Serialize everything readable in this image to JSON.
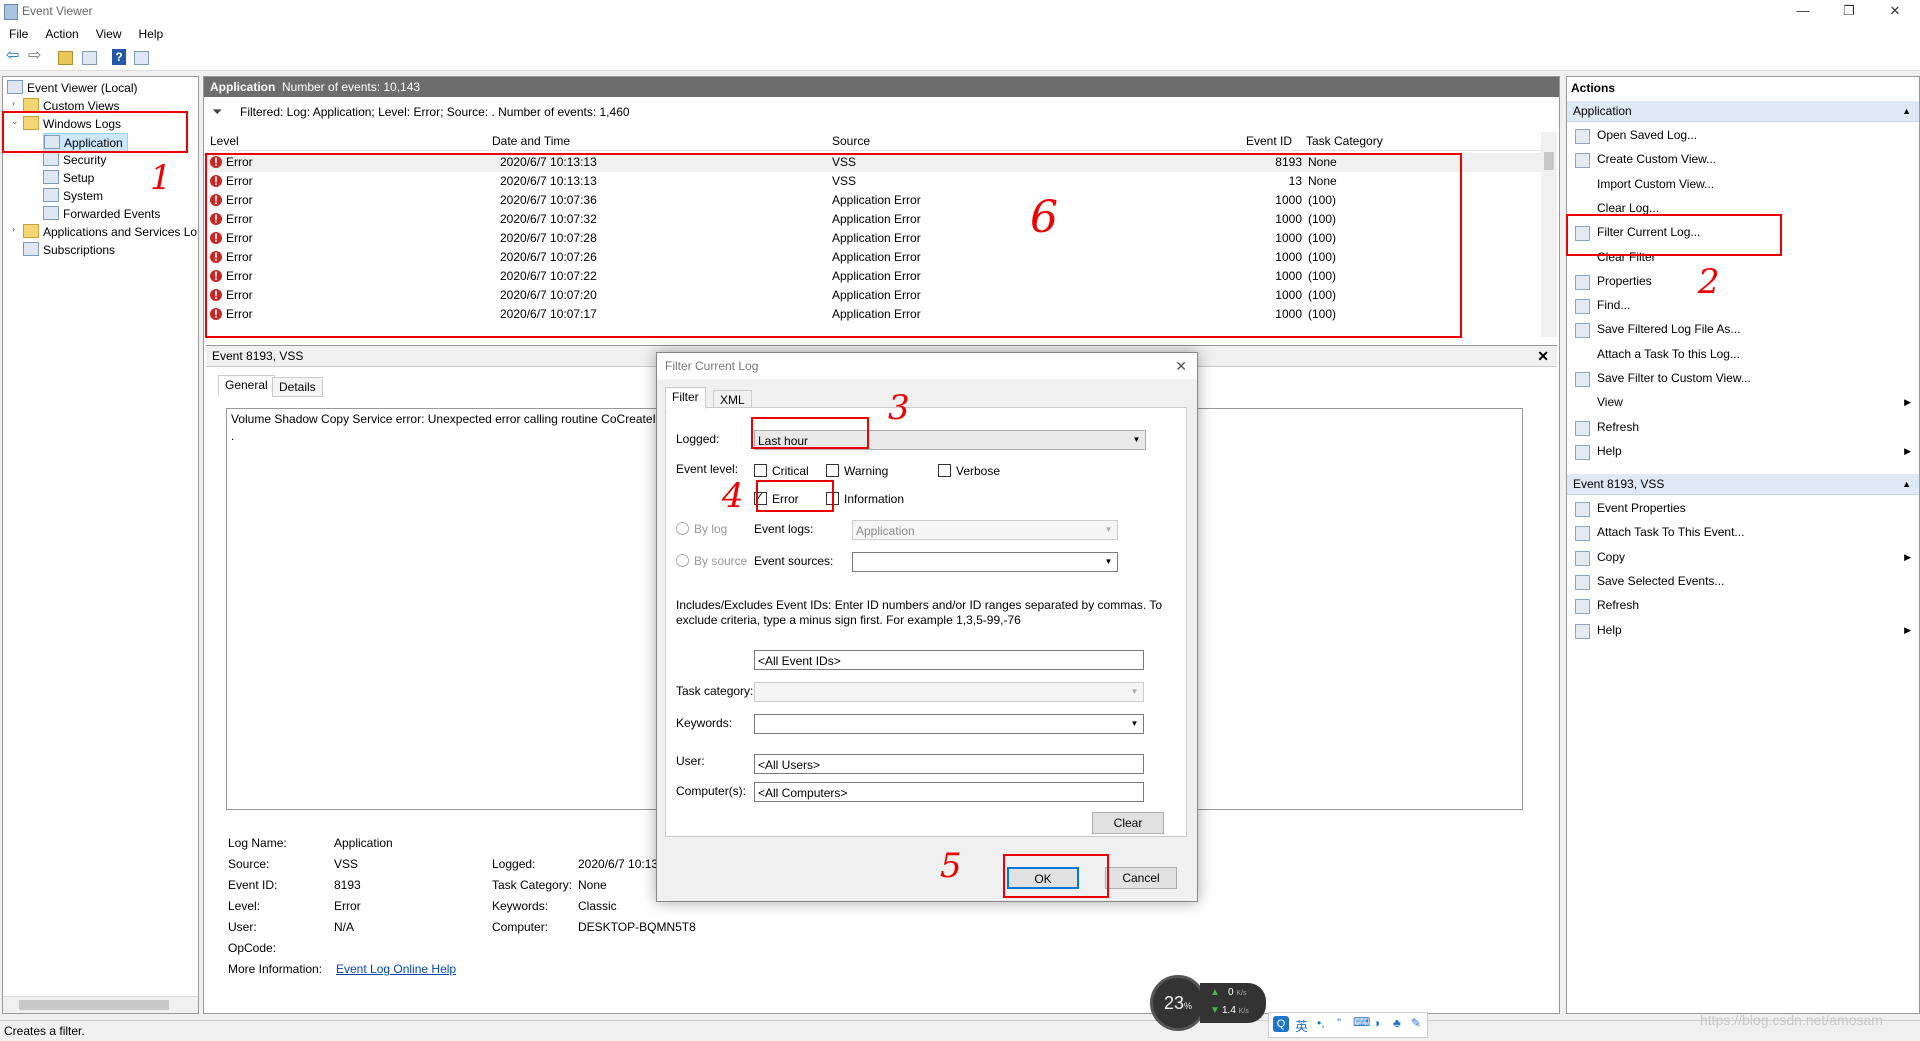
{
  "window": {
    "title": "Event Viewer",
    "buttons": [
      "—",
      "❐",
      "✕"
    ]
  },
  "menu": [
    "File",
    "Action",
    "View",
    "Help"
  ],
  "tree": {
    "items": [
      {
        "label": "Event Viewer (Local)"
      },
      {
        "label": "Custom Views"
      },
      {
        "label": "Windows Logs"
      },
      {
        "label": "Application"
      },
      {
        "label": "Security"
      },
      {
        "label": "Setup"
      },
      {
        "label": "System"
      },
      {
        "label": "Forwarded Events"
      },
      {
        "label": "Applications and Services Lo"
      },
      {
        "label": "Subscriptions"
      }
    ]
  },
  "log": {
    "name": "Application",
    "count": "Number of events: 10,143",
    "filter": "Filtered: Log: Application; Level: Error; Source: . Number of events: 1,460",
    "columns": [
      "Level",
      "Date and Time",
      "Source",
      "Event ID",
      "Task Category"
    ],
    "rows": [
      {
        "level": "Error",
        "date": "2020/6/7 10:13:13",
        "source": "VSS",
        "id": "8193",
        "cat": "None"
      },
      {
        "level": "Error",
        "date": "2020/6/7 10:13:13",
        "source": "VSS",
        "id": "13",
        "cat": "None"
      },
      {
        "level": "Error",
        "date": "2020/6/7 10:07:36",
        "source": "Application Error",
        "id": "1000",
        "cat": "(100)"
      },
      {
        "level": "Error",
        "date": "2020/6/7 10:07:32",
        "source": "Application Error",
        "id": "1000",
        "cat": "(100)"
      },
      {
        "level": "Error",
        "date": "2020/6/7 10:07:28",
        "source": "Application Error",
        "id": "1000",
        "cat": "(100)"
      },
      {
        "level": "Error",
        "date": "2020/6/7 10:07:26",
        "source": "Application Error",
        "id": "1000",
        "cat": "(100)"
      },
      {
        "level": "Error",
        "date": "2020/6/7 10:07:22",
        "source": "Application Error",
        "id": "1000",
        "cat": "(100)"
      },
      {
        "level": "Error",
        "date": "2020/6/7 10:07:20",
        "source": "Application Error",
        "id": "1000",
        "cat": "(100)"
      },
      {
        "level": "Error",
        "date": "2020/6/7 10:07:17",
        "source": "Application Error",
        "id": "1000",
        "cat": "(100)"
      }
    ]
  },
  "detail": {
    "title": "Event 8193, VSS",
    "tabs": [
      "General",
      "Details"
    ],
    "description": "Volume Shadow Copy Service error: Unexpected error calling routine CoCreateIns",
    "fields": {
      "log_name_label": "Log Name:",
      "log_name": "Application",
      "source_label": "Source:",
      "source": "VSS",
      "event_id_label": "Event ID:",
      "event_id": "8193",
      "level_label": "Level:",
      "level": "Error",
      "user_label": "User:",
      "user": "N/A",
      "opcode_label": "OpCode:",
      "more_info_label": "More Information:",
      "more_info": "Event Log Online Help",
      "logged_label": "Logged:",
      "logged": "2020/6/7 10:13:",
      "task_cat_label": "Task Category:",
      "task_cat": "None",
      "keywords_label": "Keywords:",
      "keywords": "Classic",
      "computer_label": "Computer:",
      "computer": "DESKTOP-BQMN5T8"
    }
  },
  "actions": {
    "header": "Actions",
    "section1": "Application",
    "items1": [
      {
        "label": "Open Saved Log...",
        "icon": "open-log-icon"
      },
      {
        "label": "Create Custom View...",
        "icon": "filter-icon"
      },
      {
        "label": "Import Custom View...",
        "icon": ""
      },
      {
        "label": "Clear Log...",
        "icon": ""
      },
      {
        "label": "Filter Current Log...",
        "icon": "filter-icon"
      },
      {
        "label": "Clear Filter",
        "icon": ""
      },
      {
        "label": "Properties",
        "icon": "properties-icon"
      },
      {
        "label": "Find...",
        "icon": "find-icon"
      },
      {
        "label": "Save Filtered Log File As...",
        "icon": "save-icon"
      },
      {
        "label": "Attach a Task To this Log...",
        "icon": ""
      },
      {
        "label": "Save Filter to Custom View...",
        "icon": "save-filter-icon"
      },
      {
        "label": "View",
        "icon": "",
        "submenu": true
      },
      {
        "label": "Refresh",
        "icon": "refresh-icon"
      },
      {
        "label": "Help",
        "icon": "help-icon",
        "submenu": true
      }
    ],
    "section2": "Event 8193, VSS",
    "items2": [
      {
        "label": "Event Properties",
        "icon": "properties-icon"
      },
      {
        "label": "Attach Task To This Event...",
        "icon": "task-icon"
      },
      {
        "label": "Copy",
        "icon": "copy-icon",
        "submenu": true
      },
      {
        "label": "Save Selected Events...",
        "icon": "save-icon"
      },
      {
        "label": "Refresh",
        "icon": "refresh-icon"
      },
      {
        "label": "Help",
        "icon": "help-icon",
        "submenu": true
      }
    ]
  },
  "status": "Creates a filter.",
  "dialog": {
    "title": "Filter Current Log",
    "tabs": [
      "Filter",
      "XML"
    ],
    "logged_label": "Logged:",
    "logged_value": "Last hour",
    "event_level_label": "Event level:",
    "levels": {
      "critical": "Critical",
      "warning": "Warning",
      "verbose": "Verbose",
      "error": "Error",
      "information": "Information"
    },
    "by_log": "By log",
    "by_source": "By source",
    "event_logs_label": "Event logs:",
    "event_logs_value": "Application",
    "event_sources_label": "Event sources:",
    "ids_help": "Includes/Excludes Event IDs: Enter ID numbers and/or ID ranges separated by commas. To exclude criteria, type a minus sign first. For example 1,3,5-99,-76",
    "event_ids_value": "<All Event IDs>",
    "task_category_label": "Task category:",
    "keywords_label": "Keywords:",
    "user_label": "User:",
    "user_value": "<All Users>",
    "computers_label": "Computer(s):",
    "computers_value": "<All Computers>",
    "clear": "Clear",
    "ok": "OK",
    "cancel": "Cancel"
  },
  "annotations": [
    "1",
    "2",
    "3",
    "4",
    "5",
    "6"
  ],
  "speed": {
    "percent": "23",
    "unit": "%",
    "up": "0",
    "down": "1.4",
    "rate_unit": "K/s"
  },
  "ime": {
    "lang": "英"
  },
  "watermark": "https://blog.csdn.net/amosam",
  "colors": {
    "accent": "#0078d7",
    "annotation": "#e00000",
    "error": "#c62828",
    "log_header": "#6d6d6d"
  }
}
